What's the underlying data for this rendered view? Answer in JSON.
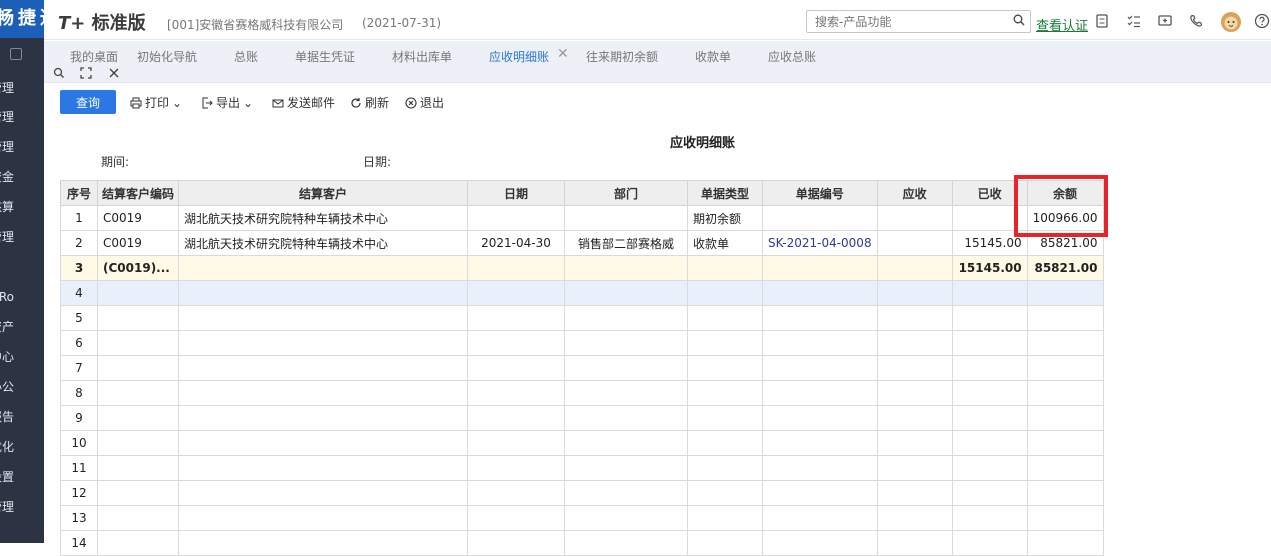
{
  "sidebar": {
    "logo": "畅捷通",
    "items": [
      "管理",
      "管理",
      "管理",
      "资金",
      "核算",
      "管理",
      "Ro",
      "资产",
      "中心",
      "办公",
      "报告",
      "优化",
      "设置",
      "管理"
    ]
  },
  "topbar": {
    "brand_prefix": "T+",
    "brand_name": "标准版",
    "company": "[001]安徽省赛格威科技有限公司",
    "date": "(2021-07-31)",
    "search_placeholder": "搜索-产品功能",
    "verify_link": "查看认证",
    "icons": [
      "calculator-icon",
      "checklist-icon",
      "message-icon",
      "phone-icon",
      "avatar-icon",
      "help-icon"
    ]
  },
  "tabs": [
    {
      "label": "我的桌面",
      "active": false
    },
    {
      "label": "初始化导航",
      "active": false
    },
    {
      "label": "总账",
      "active": false
    },
    {
      "label": "单据生凭证",
      "active": false
    },
    {
      "label": "材料出库单",
      "active": false
    },
    {
      "label": "应收明细账",
      "active": true
    },
    {
      "label": "往来期初余额",
      "active": false
    },
    {
      "label": "收款单",
      "active": false
    },
    {
      "label": "应收总账",
      "active": false
    }
  ],
  "toolbar": {
    "query": "查询",
    "print": "打印",
    "export": "导出",
    "email": "发送邮件",
    "refresh": "刷新",
    "exit": "退出"
  },
  "report": {
    "title": "应收明细账",
    "period_label": "期间:",
    "date_label": "日期:"
  },
  "table": {
    "headers": [
      "序号",
      "结算客户编码",
      "结算客户",
      "日期",
      "部门",
      "单据类型",
      "单据编号",
      "应收",
      "已收",
      "余额"
    ],
    "rows": [
      [
        "1",
        "C0019",
        "湖北航天技术研究院特种车辆技术中心",
        "",
        "",
        "期初余额",
        "",
        "",
        "",
        "100966.00"
      ],
      [
        "2",
        "C0019",
        "湖北航天技术研究院特种车辆技术中心",
        "2021-04-30",
        "销售部二部赛格威",
        "收款单",
        "SK-2021-04-0008",
        "",
        "15145.00",
        "85821.00"
      ],
      [
        "3",
        "(C0019)...",
        "",
        "",
        "",
        "",
        "",
        "",
        "15145.00",
        "85821.00"
      ],
      [
        "4",
        "",
        "",
        "",
        "",
        "",
        "",
        "",
        "",
        ""
      ],
      [
        "5",
        "",
        "",
        "",
        "",
        "",
        "",
        "",
        "",
        ""
      ],
      [
        "6",
        "",
        "",
        "",
        "",
        "",
        "",
        "",
        "",
        ""
      ],
      [
        "7",
        "",
        "",
        "",
        "",
        "",
        "",
        "",
        "",
        ""
      ],
      [
        "8",
        "",
        "",
        "",
        "",
        "",
        "",
        "",
        "",
        ""
      ],
      [
        "9",
        "",
        "",
        "",
        "",
        "",
        "",
        "",
        "",
        ""
      ],
      [
        "10",
        "",
        "",
        "",
        "",
        "",
        "",
        "",
        "",
        ""
      ],
      [
        "11",
        "",
        "",
        "",
        "",
        "",
        "",
        "",
        "",
        ""
      ],
      [
        "12",
        "",
        "",
        "",
        "",
        "",
        "",
        "",
        "",
        ""
      ],
      [
        "13",
        "",
        "",
        "",
        "",
        "",
        "",
        "",
        "",
        ""
      ],
      [
        "14",
        "",
        "",
        "",
        "",
        "",
        "",
        "",
        "",
        ""
      ]
    ]
  },
  "colors": {
    "accent": "#2b78e4",
    "highlight": "#e8232e",
    "sidebar": "#2c3444",
    "subtotal": "#fffae5"
  }
}
